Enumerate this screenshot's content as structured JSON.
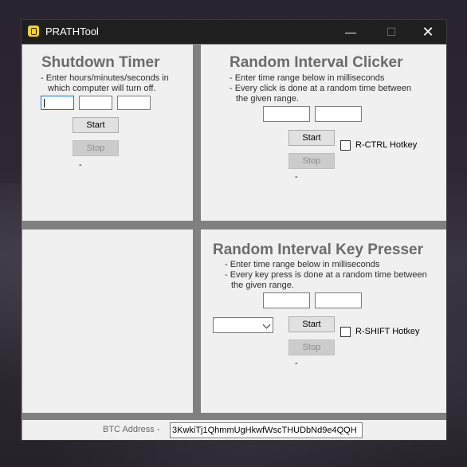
{
  "window": {
    "title": "PRATHTool",
    "minimize_glyph": "—",
    "maximize_glyph": "☐",
    "close_glyph": "✕"
  },
  "shutdown": {
    "title": "Shutdown Timer",
    "desc_line1": "- Enter hours/minutes/seconds in",
    "desc_line2": "which computer will turn off.",
    "hours_value": "",
    "minutes_value": "",
    "seconds_value": "",
    "start_label": "Start",
    "stop_label": "Stop",
    "status": "-"
  },
  "clicker": {
    "title": "Random Interval Clicker",
    "desc_line1": "- Enter time range below in milliseconds",
    "desc_line2": "- Every click is done at a random time between",
    "desc_line3": "the given range.",
    "min_value": "",
    "max_value": "",
    "start_label": "Start",
    "stop_label": "Stop",
    "hotkey_label": "R-CTRL Hotkey",
    "status": "-"
  },
  "presser": {
    "title": "Random Interval Key Presser",
    "desc_line1": "- Enter time range below in milliseconds",
    "desc_line2": "- Every key press is done at a random time between",
    "desc_line3": "the given range.",
    "min_value": "",
    "max_value": "",
    "key_selected": "",
    "start_label": "Start",
    "stop_label": "Stop",
    "hotkey_label": "R-SHIFT Hotkey",
    "status": "-"
  },
  "footer": {
    "btc_label": "BTC Address -",
    "btc_address": "3KwkiTj1QhmmUgHkwfWscTHUDbNd9e4QQH"
  }
}
